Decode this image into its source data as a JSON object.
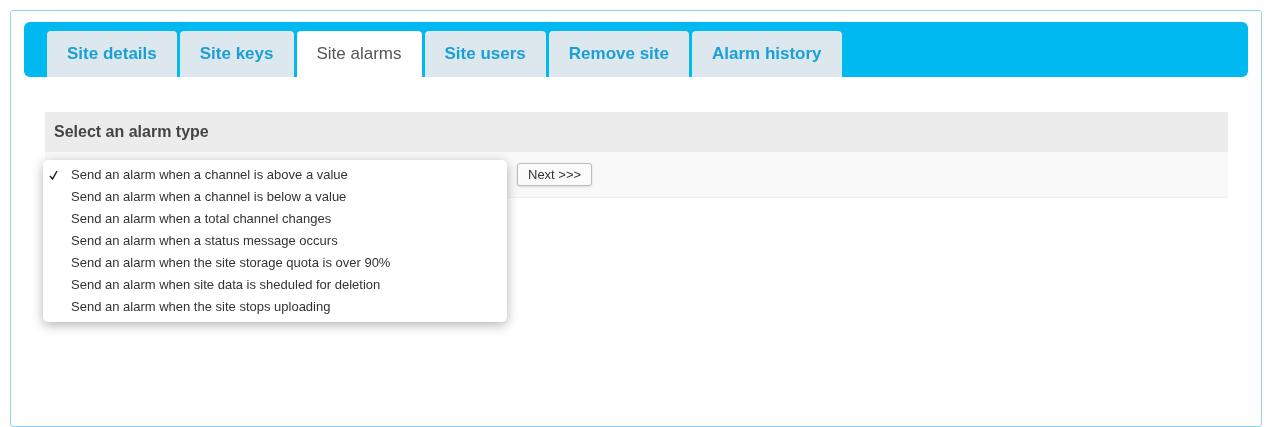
{
  "tabs": [
    {
      "label": "Site details",
      "selected": false
    },
    {
      "label": "Site keys",
      "selected": false
    },
    {
      "label": "Site alarms",
      "selected": true
    },
    {
      "label": "Site users",
      "selected": false
    },
    {
      "label": "Remove site",
      "selected": false
    },
    {
      "label": "Alarm history",
      "selected": false
    }
  ],
  "section": {
    "title": "Select an alarm type"
  },
  "dropdown": {
    "options": [
      {
        "label": "Send an alarm when a channel is above a value",
        "selected": true
      },
      {
        "label": "Send an alarm when a channel is below a value",
        "selected": false
      },
      {
        "label": "Send an alarm when a total channel changes",
        "selected": false
      },
      {
        "label": "Send an alarm when a status message occurs",
        "selected": false
      },
      {
        "label": "Send an alarm when the site storage quota is over 90%",
        "selected": false
      },
      {
        "label": "Send an alarm when site data is sheduled for deletion",
        "selected": false
      },
      {
        "label": "Send an alarm when the site stops uploading",
        "selected": false
      }
    ]
  },
  "next_button": {
    "label": "Next >>>"
  }
}
